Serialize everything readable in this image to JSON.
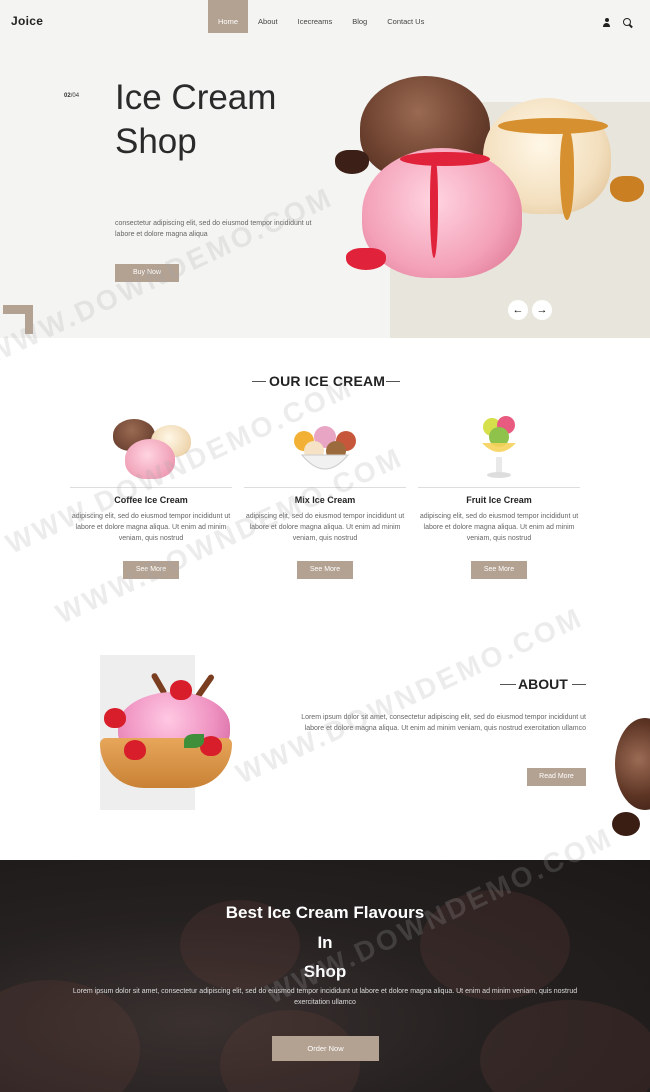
{
  "header": {
    "logo": "Joice",
    "nav": [
      {
        "label": "Home",
        "active": true
      },
      {
        "label": "About",
        "active": false
      },
      {
        "label": "Icecreams",
        "active": false
      },
      {
        "label": "Blog",
        "active": false
      },
      {
        "label": "Contact Us",
        "active": false
      }
    ],
    "icons": [
      "user-icon",
      "search-icon"
    ]
  },
  "hero": {
    "slide_current": "02",
    "slide_total": "/04",
    "title": "Ice Cream Shop",
    "text": "consectetur adipiscing elit, sed do eiusmod tempor incididunt ut labore et dolore magna aliqua",
    "button": "Buy Now",
    "prev_arrow": "←",
    "next_arrow": "→"
  },
  "our_ice_cream": {
    "title": "OUR ICE CREAM",
    "products": [
      {
        "name": "Coffee Ice Cream",
        "desc": "adipiscing elit, sed do eiusmod tempor incididunt ut labore et dolore magna aliqua. Ut enim ad minim veniam, quis nostrud",
        "button": "See More"
      },
      {
        "name": "Mix Ice Cream",
        "desc": "adipiscing elit, sed do eiusmod tempor incididunt ut labore et dolore magna aliqua. Ut enim ad minim veniam, quis nostrud",
        "button": "See More"
      },
      {
        "name": "Fruit Ice Cream",
        "desc": "adipiscing elit, sed do eiusmod tempor incididunt ut labore et dolore magna aliqua. Ut enim ad minim veniam, quis nostrud",
        "button": "See More"
      }
    ]
  },
  "about": {
    "title": "ABOUT",
    "text": "Lorem ipsum dolor sit amet, consectetur adipiscing elit, sed do eiusmod tempor incididunt ut labore et dolore magna aliqua. Ut enim ad minim veniam, quis nostrud exercitation ullamco",
    "button": "Read More"
  },
  "banner": {
    "title_lines": [
      "Best Ice Cream Flavours",
      "In",
      "Shop"
    ],
    "text": "Lorem ipsum dolor sit amet, consectetur adipiscing elit, sed do eiusmod tempor incididunt ut labore et dolore magna aliqua. Ut enim ad minim veniam, quis nostrud exercitation ullamco",
    "button": "Order Now"
  },
  "watermark": "WWW.DOWNDEMO.COM",
  "colors": {
    "accent": "#b3a191",
    "hero_bg": "#f4f4f2",
    "hero_panel": "#e8e6dc",
    "banner_bg": "#262121"
  }
}
